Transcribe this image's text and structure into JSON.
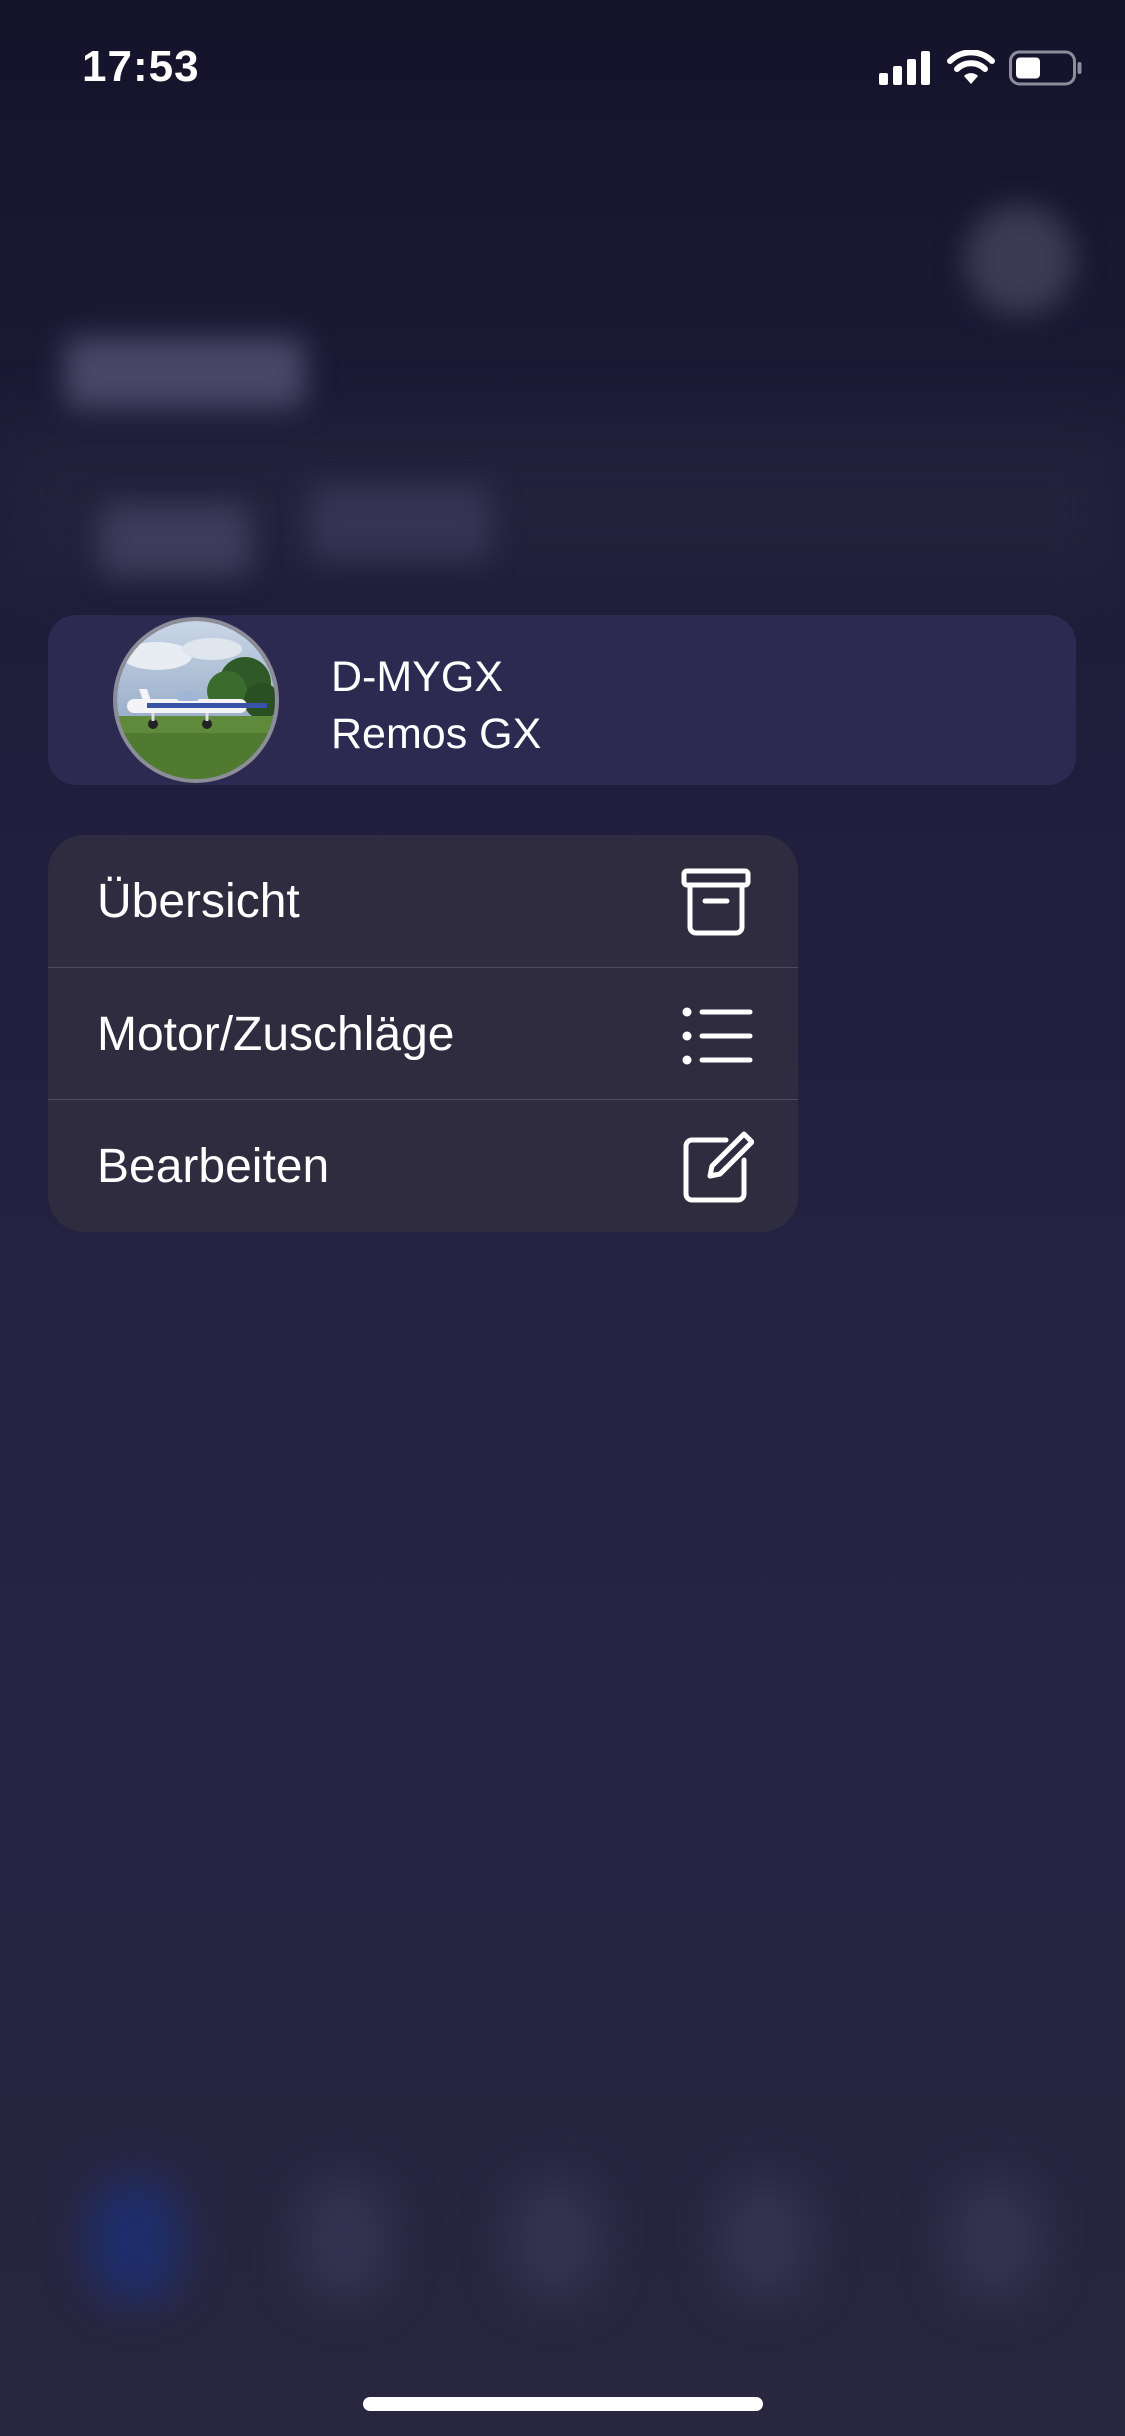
{
  "status_bar": {
    "time": "17:53",
    "icons": [
      "cellular-signal-icon",
      "wifi-icon",
      "battery-icon"
    ]
  },
  "aircraft": {
    "registration": "D-MYGX",
    "model": "Remos GX",
    "avatar_icon": "aircraft-photo"
  },
  "context_menu": {
    "items": [
      {
        "label": "Übersicht",
        "icon": "archive-box-icon"
      },
      {
        "label": "Motor/Zuschläge",
        "icon": "list-bullet-icon"
      },
      {
        "label": "Bearbeiten",
        "icon": "square-pencil-icon"
      }
    ]
  },
  "colors": {
    "card_background": "#2c2a50",
    "menu_background": "#2e2c3e",
    "page_background": "#22203f"
  }
}
